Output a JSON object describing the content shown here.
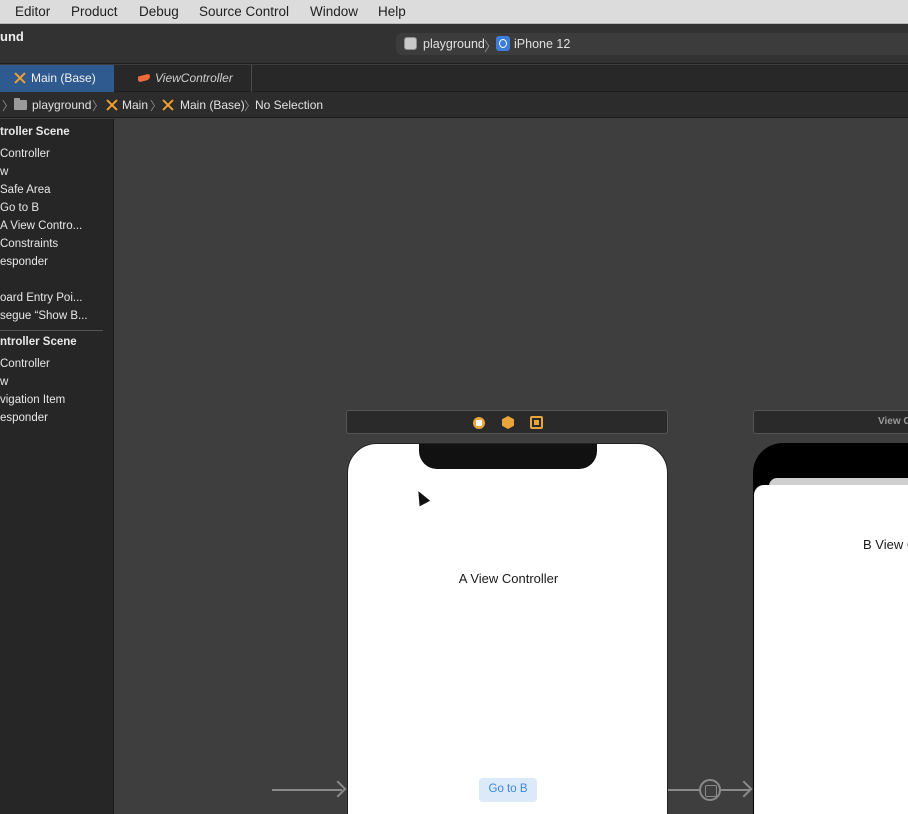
{
  "menubar": {
    "items": [
      "Editor",
      "Product",
      "Debug",
      "Source Control",
      "Window",
      "Help"
    ]
  },
  "toolbar": {
    "project_name": "und",
    "scheme": "playground",
    "device": "iPhone 12"
  },
  "tabs": [
    {
      "label": "Main (Base)",
      "active": true
    },
    {
      "label": "ViewController",
      "active": false
    }
  ],
  "jumpbar": {
    "items": [
      "playground",
      "Main",
      "Main (Base)",
      "No Selection"
    ]
  },
  "outline": {
    "items": [
      {
        "label": "troller Scene",
        "bold": true
      },
      {
        "label": "Controller",
        "bold": false
      },
      {
        "label": "w",
        "bold": false
      },
      {
        "label": "Safe Area",
        "bold": false
      },
      {
        "label": "Go to B",
        "bold": false
      },
      {
        "label": "A View Contro...",
        "bold": false
      },
      {
        "label": "Constraints",
        "bold": false
      },
      {
        "label": "esponder",
        "bold": false
      },
      {
        "label": "oard Entry Poi...",
        "bold": false
      },
      {
        "label": "segue “Show B...",
        "bold": false
      },
      {
        "label": "ntroller Scene",
        "bold": true
      },
      {
        "label": "Controller",
        "bold": false
      },
      {
        "label": "w",
        "bold": false
      },
      {
        "label": "vigation Item",
        "bold": false
      },
      {
        "label": "esponder",
        "bold": false
      }
    ]
  },
  "canvas": {
    "scene_a": {
      "label": "A View Controller",
      "button": "Go to B"
    },
    "scene_b": {
      "dock_title": "View C",
      "label": "B View C"
    }
  },
  "colors": {
    "accent_tab": "#2f5a8f",
    "ib_icon": "#f0a030",
    "button_text": "#3d86e0"
  }
}
